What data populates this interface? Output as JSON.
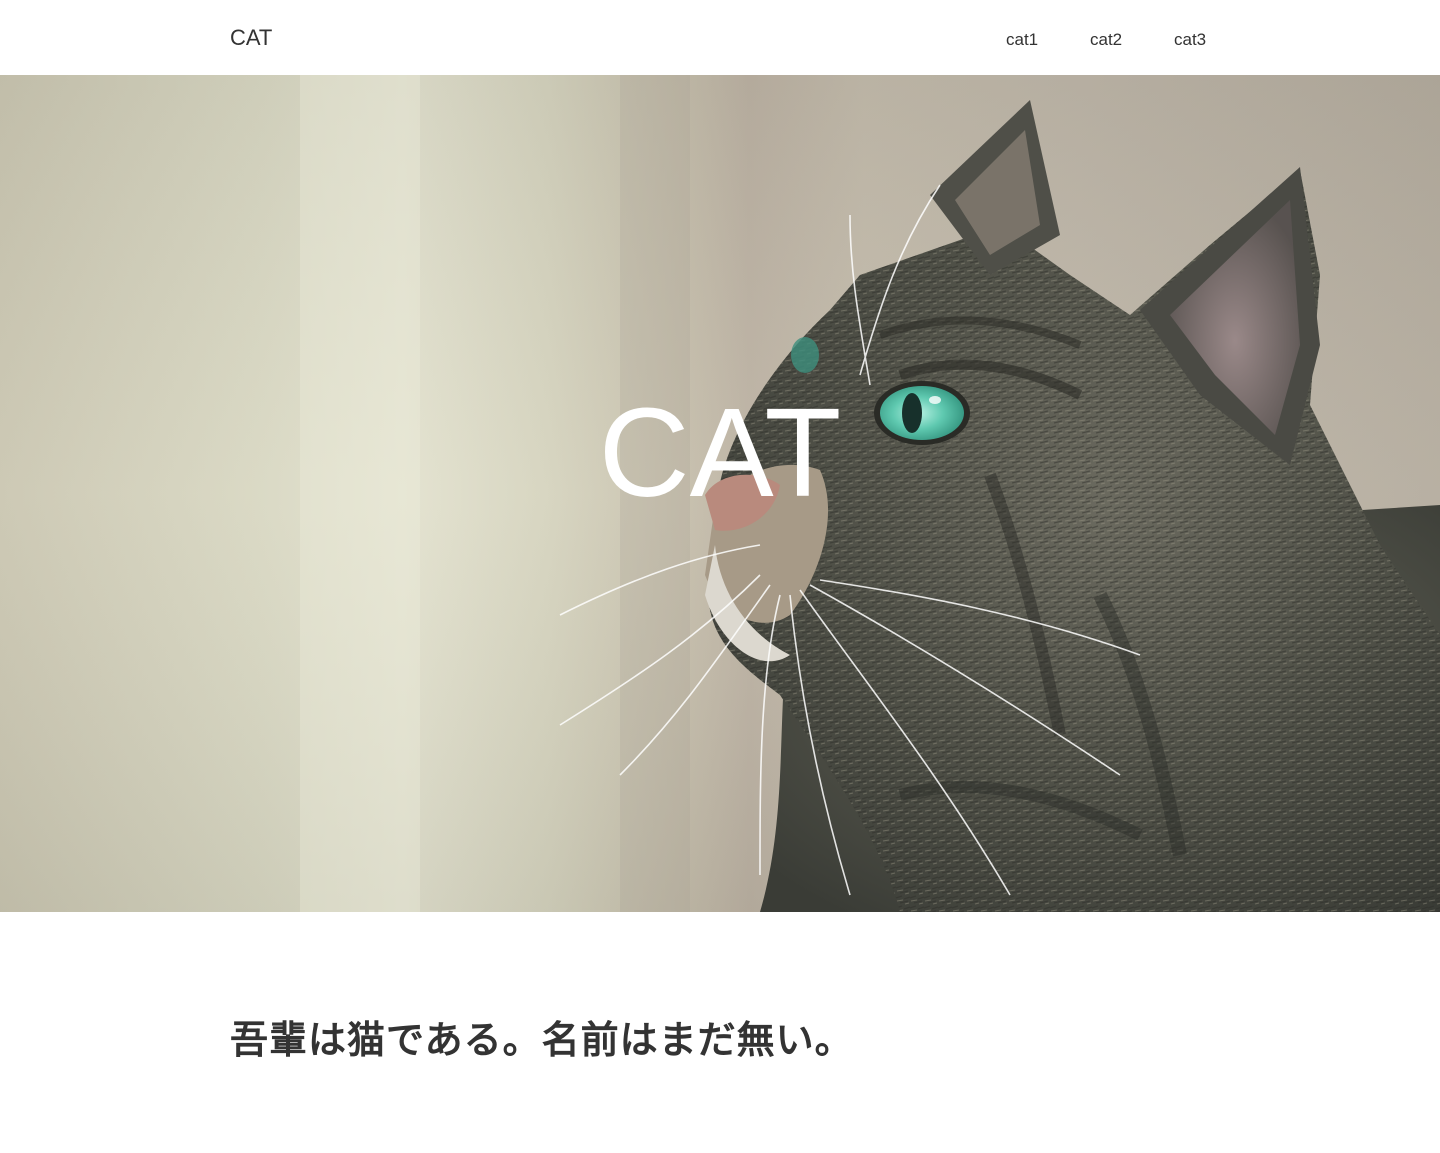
{
  "header": {
    "logo": "CAT",
    "nav": [
      {
        "label": "cat1"
      },
      {
        "label": "cat2"
      },
      {
        "label": "cat3"
      }
    ]
  },
  "hero": {
    "title": "CAT",
    "image": "tabby-cat-looking-up-photo"
  },
  "content": {
    "lead": "吾輩は猫である。名前はまだ無い。"
  },
  "colors": {
    "text": "#333333",
    "hero_title": "#ffffff",
    "background": "#ffffff"
  }
}
